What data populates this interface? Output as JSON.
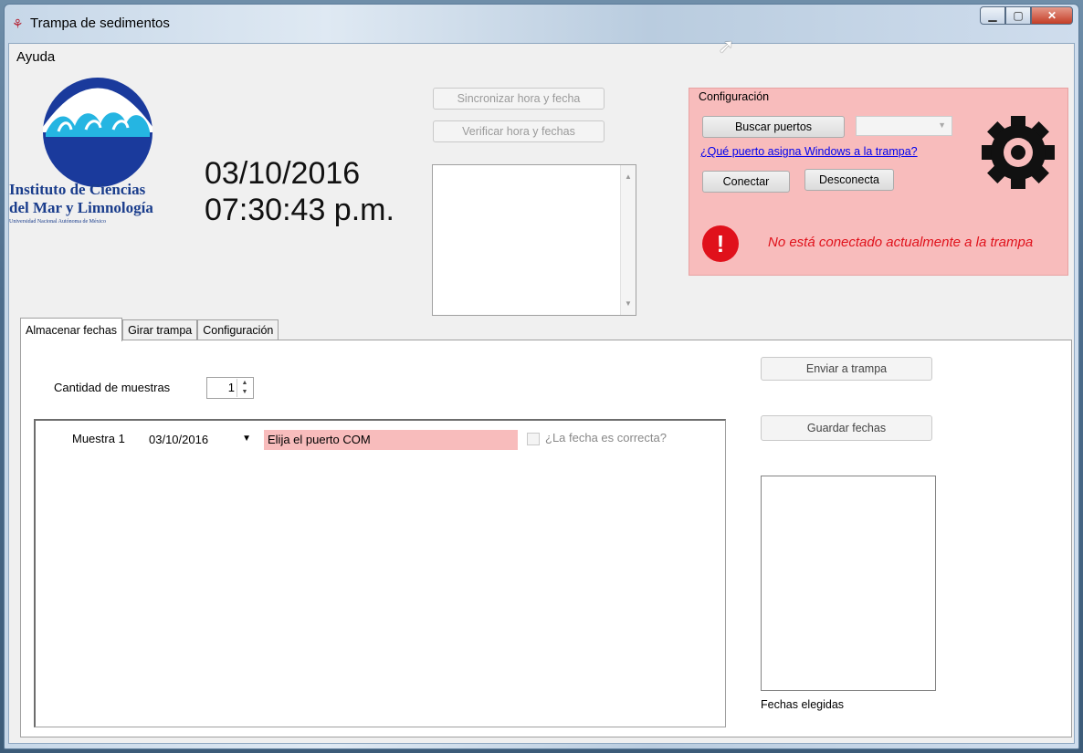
{
  "window": {
    "title": "Trampa de sedimentos",
    "icon": "app-trap-icon"
  },
  "menu": {
    "help": "Ayuda"
  },
  "logo": {
    "line1": "Instituto de Ciencias",
    "line2": "del Mar y Limnología",
    "line3": "Universidad Nacional Autónoma de México"
  },
  "clock": {
    "date": "03/10/2016",
    "time": "07:30:43 p.m."
  },
  "top_buttons": {
    "sync": "Sincronizar hora y fecha",
    "verify": "Verificar hora y fechas"
  },
  "config": {
    "legend": "Configuración",
    "search_ports": "Buscar puertos",
    "port_combo_value": "",
    "help_link": "¿Qué puerto asigna Windows a la trampa?",
    "connect": "Conectar",
    "disconnect": "Desconecta",
    "status_text": "No está conectado actualmente a la trampa",
    "status_color": "#e0111b",
    "bg_color": "#f8bcbc"
  },
  "tabs": [
    {
      "label": "Almacenar fechas",
      "active": true
    },
    {
      "label": "Girar trampa",
      "active": false
    },
    {
      "label": "Configuración",
      "active": false
    }
  ],
  "store_tab": {
    "sample_count_label": "Cantidad de muestras",
    "sample_count": "1",
    "send_button": "Enviar a trampa",
    "save_button": "Guardar fechas",
    "chosen_dates_label": "Fechas elegidas",
    "samples": [
      {
        "label": "Muestra 1",
        "date": "03/10/2016",
        "port_message": "Elija el puerto COM",
        "confirm_label": "¿La fecha es correcta?",
        "confirmed": false
      }
    ]
  }
}
